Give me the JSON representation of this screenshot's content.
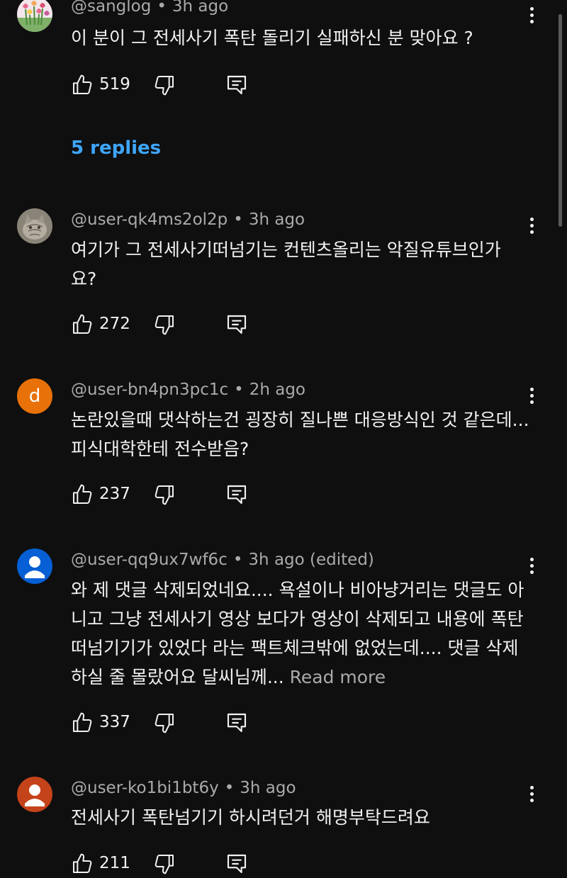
{
  "comments": [
    {
      "handle": "@sanglog",
      "time": "3h ago",
      "edited": "",
      "text": "이 분이 그 전세사기 폭탄 돌리기 실패하신 분 맞아요 ?",
      "read_more": "",
      "likes": "519",
      "replies": "5 replies"
    },
    {
      "handle": "@user-qk4ms2ol2p",
      "time": "3h ago",
      "edited": "",
      "text": "여기가 그 전세사기떠넘기는 컨텐츠올리는  악질유튜브인가요?",
      "read_more": "",
      "likes": "272"
    },
    {
      "handle": "@user-bn4pn3pc1c",
      "time": "2h ago",
      "edited": "",
      "avatar_letter": "d",
      "text": "논란있을때 댓삭하는건 굉장히 질나쁜 대응방식인 것 같은데...피식대학한테 전수받음?",
      "read_more": "",
      "likes": "237"
    },
    {
      "handle": "@user-qq9ux7wf6c",
      "time": "3h ago",
      "edited": "(edited)",
      "text": "와 제 댓글 삭제되었네요.... 욕설이나 비아냥거리는 댓글도 아니고 그냥 전세사기 영상 보다가 영상이 삭제되고 내용에 폭탄떠넘기기가 있었다 라는 팩트체크밖에 없었는데.... 댓글 삭제하실 줄 몰랐어요 달씨님께...",
      "read_more": "Read more",
      "likes": "337"
    },
    {
      "handle": "@user-ko1bi1bt6y",
      "time": "3h ago",
      "edited": "",
      "text": "전세사기 폭탄넘기기 하시려던거 해명부탁드려요",
      "read_more": "",
      "likes": "211"
    }
  ],
  "colors": {
    "background": "#0f0f0f",
    "text": "#f1f1f1",
    "secondary": "#aaaaaa",
    "link": "#3ea6ff",
    "avatar_orange": "#e8710a",
    "avatar_blue": "#065fd4",
    "avatar_red": "#c5431a"
  },
  "icons": {
    "like": "thumbs-up-icon",
    "dislike": "thumbs-down-icon",
    "reply": "comment-icon",
    "menu": "more-vert-icon"
  }
}
